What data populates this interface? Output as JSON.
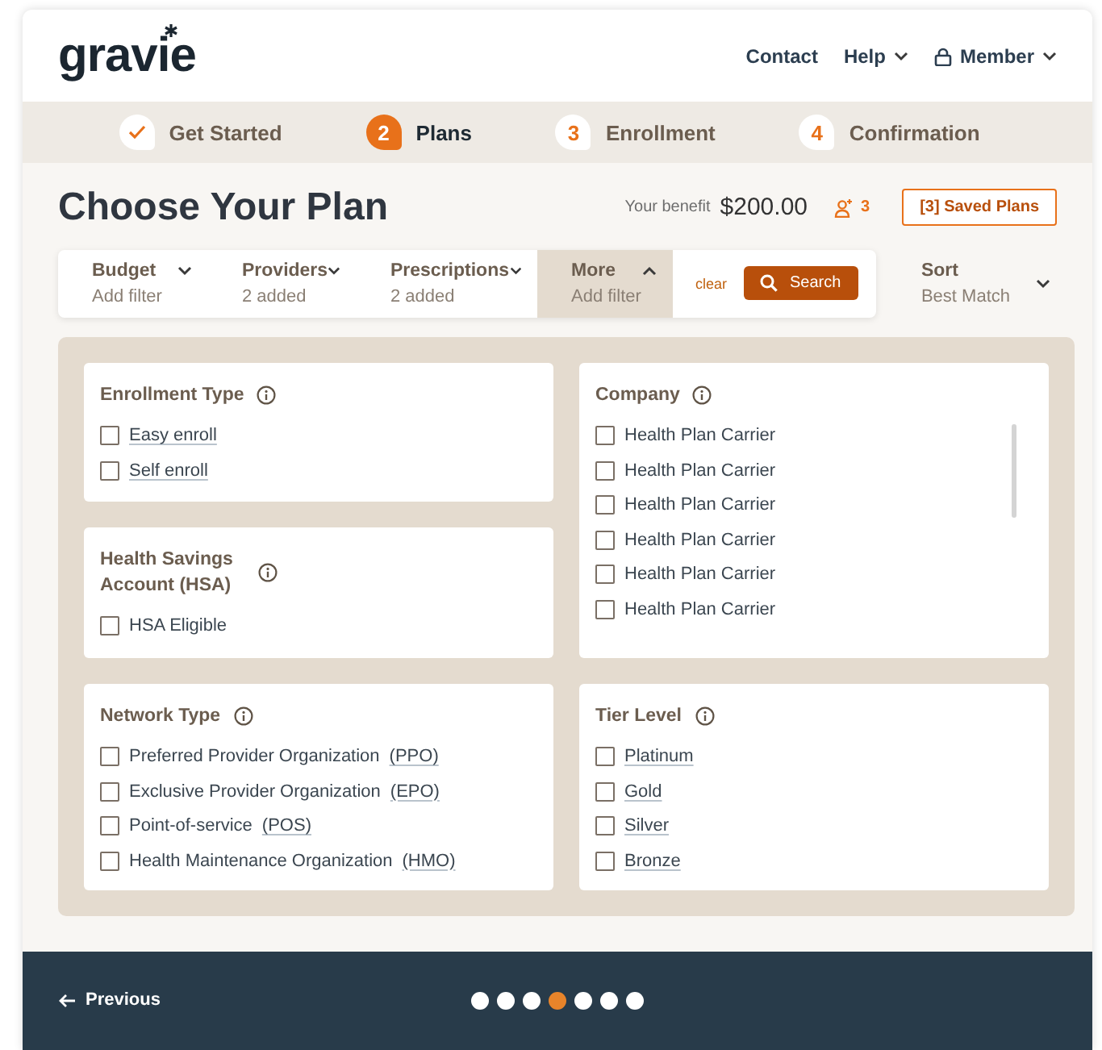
{
  "header": {
    "logo": "gravie",
    "nav": [
      {
        "label": "Contact",
        "kind": "link"
      },
      {
        "label": "Help",
        "kind": "menu"
      },
      {
        "label": "Member",
        "kind": "account"
      }
    ]
  },
  "steps": [
    {
      "label": "Get Started",
      "completed": true,
      "selected": false
    },
    {
      "label": "Plans",
      "number": "2",
      "completed": false,
      "selected": true
    },
    {
      "label": "Enrollment",
      "number": "3",
      "completed": false,
      "selected": false
    },
    {
      "label": "Confirmation",
      "number": "4",
      "completed": false,
      "selected": false
    }
  ],
  "page": {
    "title": "Choose Your Plan",
    "benefit_label": "Your benefit",
    "benefit_amount": "$200.00",
    "household_count": "3",
    "saved_plans": "[3] Saved Plans"
  },
  "filters": [
    {
      "label": "Budget",
      "value": "Add filter",
      "expanded": false
    },
    {
      "label": "Providers",
      "value": "2 added",
      "expanded": false
    },
    {
      "label": "Prescriptions",
      "value": "2 added",
      "expanded": false
    },
    {
      "label": "More",
      "value": "Add filter",
      "expanded": true
    }
  ],
  "clear": "clear",
  "search_button": "Search",
  "sort": {
    "label": "Sort",
    "value": "Best Match"
  },
  "groups": [
    {
      "title": "Enrollment Type",
      "scrollable": false,
      "options": [
        {
          "label": "Easy enroll",
          "kind": "link",
          "checked": false
        },
        {
          "label": "Self enroll",
          "kind": "link",
          "checked": false
        }
      ]
    },
    {
      "title": "Company",
      "scrollable": true,
      "options": [
        {
          "label": "Health Plan Carrier",
          "kind": "plain",
          "checked": false
        },
        {
          "label": "Health Plan Carrier",
          "kind": "plain",
          "checked": false
        },
        {
          "label": "Health Plan Carrier",
          "kind": "plain",
          "checked": false
        },
        {
          "label": "Health Plan Carrier",
          "kind": "plain",
          "checked": false
        },
        {
          "label": "Health Plan Carrier",
          "kind": "plain",
          "checked": false
        },
        {
          "label": "Health Plan Carrier",
          "kind": "plain",
          "checked": false
        }
      ]
    },
    {
      "title": "Health Savings Account (HSA)",
      "scrollable": false,
      "options": [
        {
          "label": "HSA Eligible",
          "kind": "plain",
          "checked": false
        }
      ]
    },
    {
      "title": "Network Type",
      "scrollable": false,
      "options": [
        {
          "label": "Preferred Provider Organization",
          "abbr": "(PPO)",
          "kind": "abbr",
          "checked": false
        },
        {
          "label": "Exclusive Provider Organization",
          "abbr": "(EPO)",
          "kind": "abbr",
          "checked": false
        },
        {
          "label": "Point-of-service",
          "abbr": "(POS)",
          "kind": "abbr",
          "checked": false
        },
        {
          "label": "Health Maintenance Organization",
          "abbr": "(HMO)",
          "kind": "abbr",
          "checked": false
        }
      ]
    },
    {
      "title": "Tier Level",
      "scrollable": false,
      "options": [
        {
          "label": "Platinum",
          "kind": "link",
          "checked": false
        },
        {
          "label": "Gold",
          "kind": "link",
          "checked": false
        },
        {
          "label": "Silver",
          "kind": "link",
          "checked": false
        },
        {
          "label": "Bronze",
          "kind": "link",
          "checked": false
        }
      ]
    }
  ],
  "footer": {
    "previous": "Previous",
    "pages": [
      {
        "selected": false
      },
      {
        "selected": false
      },
      {
        "selected": false
      },
      {
        "selected": true
      },
      {
        "selected": false
      },
      {
        "selected": false
      },
      {
        "selected": false
      }
    ]
  }
}
